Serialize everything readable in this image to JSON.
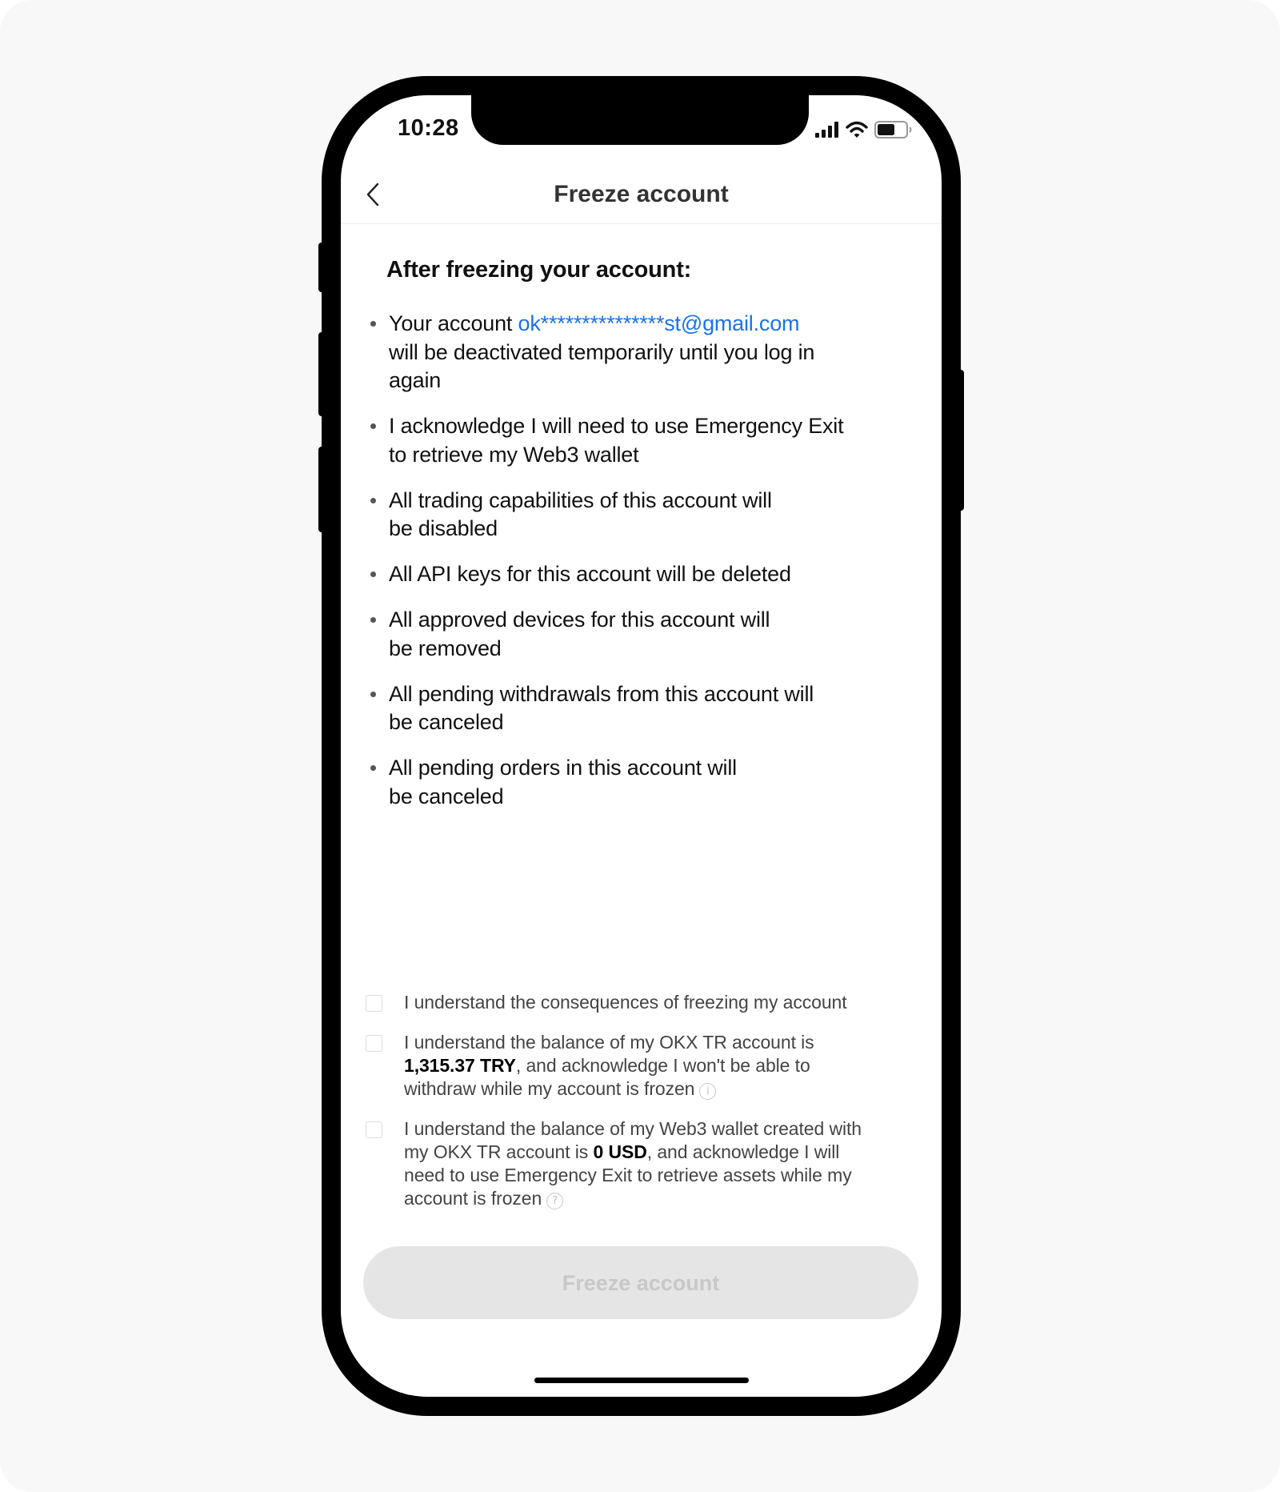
{
  "status_bar": {
    "time": "10:28",
    "icons": [
      "cellular-signal-icon",
      "wifi-icon",
      "battery-icon"
    ],
    "battery_level": 0.6
  },
  "header": {
    "back_icon": "chevron-left-icon",
    "title": "Freeze account"
  },
  "content": {
    "heading": "After freezing your account:",
    "bullets": [
      {
        "lines": [
          "Your account ",
          "will be deactivated temporarily until you log in",
          "again"
        ],
        "email": "ok***************st@gmail.com"
      },
      {
        "lines": [
          "I acknowledge I will need to use Emergency Exit",
          "to retrieve my Web3 wallet"
        ]
      },
      {
        "lines": [
          "All trading capabilities of this account will",
          "be disabled"
        ]
      },
      {
        "lines": [
          "All API keys for this account will be deleted"
        ]
      },
      {
        "lines": [
          "All approved devices for this account will",
          "be removed"
        ]
      },
      {
        "lines": [
          "All pending withdrawals from this account will",
          "be canceled"
        ]
      },
      {
        "lines": [
          "All pending orders in this account will",
          "be canceled"
        ]
      }
    ]
  },
  "confirmations": [
    {
      "checked": false,
      "line1": "I understand the consequences of freezing my account"
    },
    {
      "checked": false,
      "line1": "I understand the balance of my OKX TR account is",
      "amount": "1,315.37 TRY",
      "line2_rest": ", and acknowledge I won't be able to",
      "line3": "withdraw while my account is frozen",
      "hint_icon": "info-icon",
      "hint_glyph": "i"
    },
    {
      "checked": false,
      "line1": "I understand the balance of my Web3 wallet created with",
      "line2_pre": "my OKX TR account is ",
      "amount": "0 USD",
      "line2_rest": ", and acknowledge I will",
      "line3": "need to use Emergency Exit to retrieve assets while my",
      "line4": "account is frozen",
      "hint_icon": "help-icon",
      "hint_glyph": "?"
    }
  ],
  "footer": {
    "freeze_button_label": "Freeze account",
    "freeze_button_enabled": false
  },
  "colors": {
    "link": "#1a73e8",
    "button_disabled_bg": "#e5e5e5",
    "button_disabled_text": "#c8c8c8"
  }
}
